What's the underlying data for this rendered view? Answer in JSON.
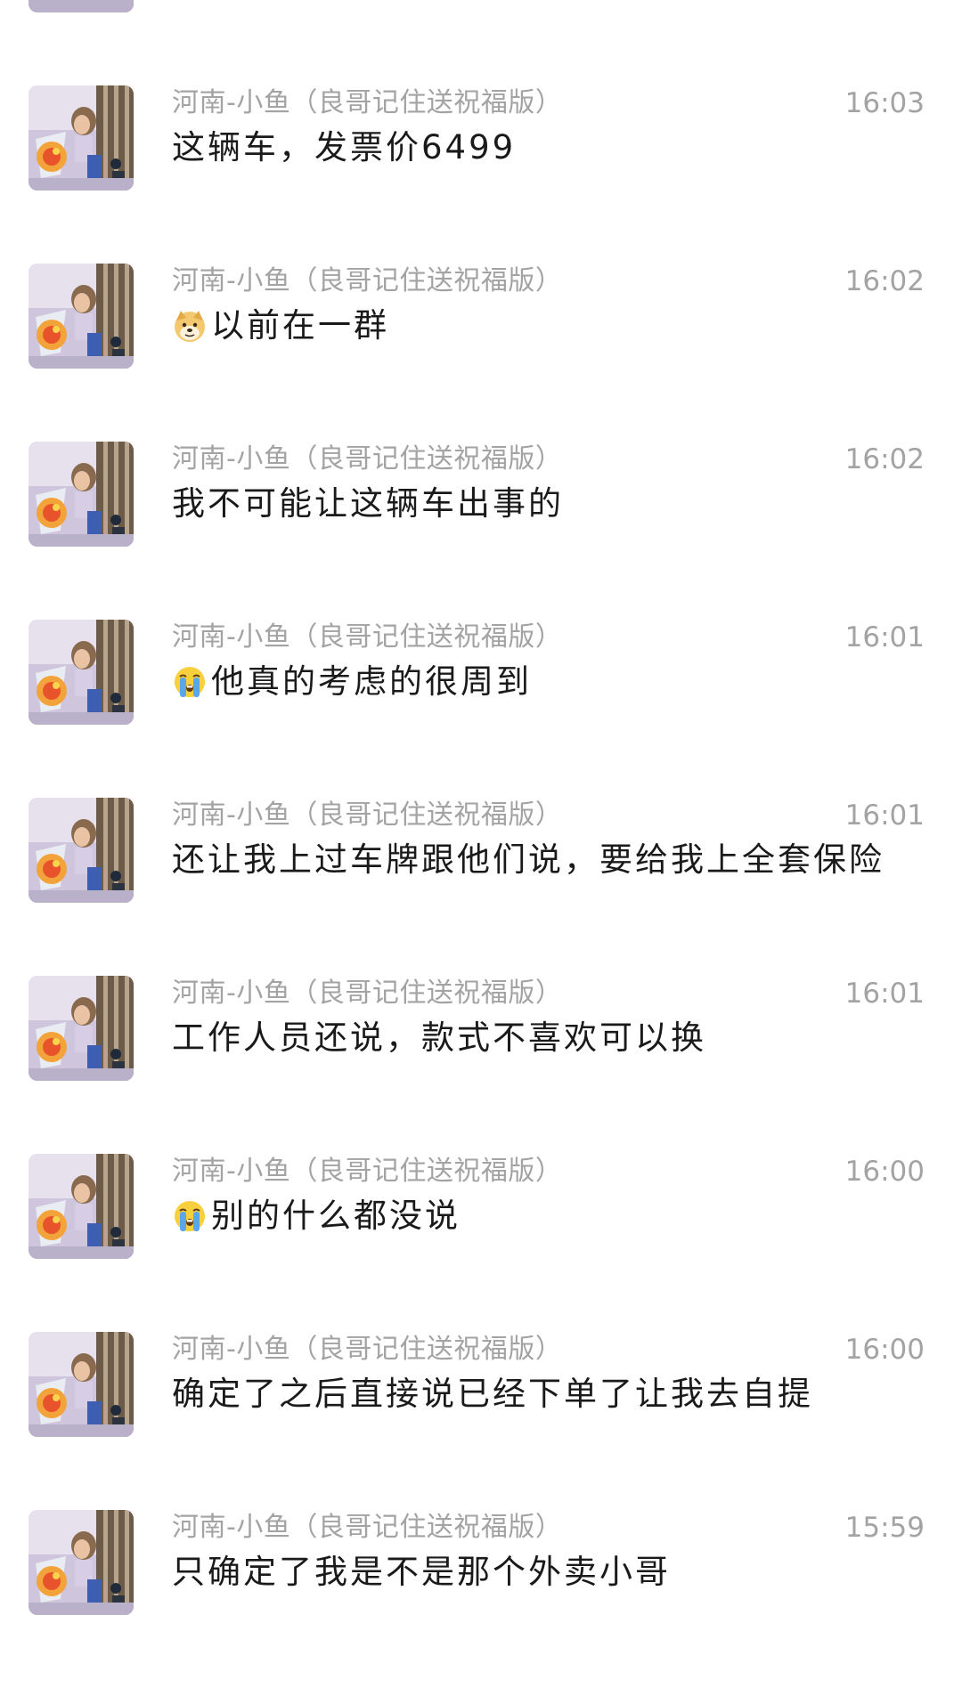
{
  "messages": [
    {
      "sender": "河南-小鱼（良哥记住送祝福版）",
      "time": "16:03",
      "text": "这辆车，发票价6499",
      "emoji": ""
    },
    {
      "sender": "河南-小鱼（良哥记住送祝福版）",
      "time": "16:02",
      "text": "以前在一群",
      "emoji": "doge-emoji"
    },
    {
      "sender": "河南-小鱼（良哥记住送祝福版）",
      "time": "16:02",
      "text": "我不可能让这辆车出事的",
      "emoji": ""
    },
    {
      "sender": "河南-小鱼（良哥记住送祝福版）",
      "time": "16:01",
      "text": "他真的考虑的很周到",
      "emoji": "crying-emoji"
    },
    {
      "sender": "河南-小鱼（良哥记住送祝福版）",
      "time": "16:01",
      "text": "还让我上过车牌跟他们说，要给我上全套保险",
      "emoji": ""
    },
    {
      "sender": "河南-小鱼（良哥记住送祝福版）",
      "time": "16:01",
      "text": "工作人员还说，款式不喜欢可以换",
      "emoji": ""
    },
    {
      "sender": "河南-小鱼（良哥记住送祝福版）",
      "time": "16:00",
      "text": "别的什么都没说",
      "emoji": "crying-emoji"
    },
    {
      "sender": "河南-小鱼（良哥记住送祝福版）",
      "time": "16:00",
      "text": "确定了之后直接说已经下单了让我去自提",
      "emoji": ""
    },
    {
      "sender": "河南-小鱼（良哥记住送祝福版）",
      "time": "15:59",
      "text": "只确定了我是不是那个外卖小哥",
      "emoji": ""
    }
  ],
  "colors": {
    "sender_gray": "#a3a3a3",
    "text_dark": "#1a1a1a",
    "background": "#ffffff"
  }
}
